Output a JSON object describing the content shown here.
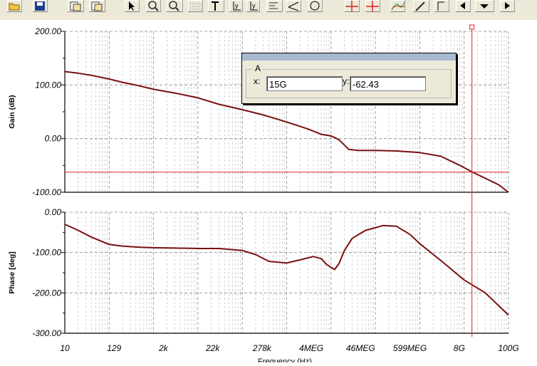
{
  "colors": {
    "trace": "#7a1010",
    "cursor": "#e02020",
    "grid": "#b4b4b4",
    "toolbar_bg": "#ece9d8"
  },
  "toolbar": {
    "icons": [
      "open-folder-icon",
      "save-icon",
      "copy-icon",
      "paste-icon",
      "pointer-icon",
      "zoom-icon",
      "zoom-100-icon",
      "grid-icon",
      "text-tool-icon",
      "axis-y-icon",
      "axis-y2-icon",
      "format-icon",
      "line-tool-icon",
      "circle-tool-icon",
      "cursor-a-icon",
      "cursor-b-icon",
      "curves-icon",
      "pen-icon",
      "marker-icon",
      "scroll-left-icon",
      "dropdown-icon",
      "scroll-right-icon"
    ]
  },
  "cursor_window": {
    "group_label": "A",
    "x_label": "x:",
    "y_label": "y:",
    "x_value": "15G",
    "y_value": "-62.43"
  },
  "chart_data": [
    {
      "type": "line",
      "ylabel": "Gain (dB)",
      "ylim": [
        -100,
        200
      ],
      "yticks": [
        "200.00",
        "100.00",
        "0.00",
        "-100.00"
      ],
      "xscale": "log",
      "xlim": [
        10,
        100000000000
      ],
      "grid": true,
      "x": [
        10,
        20,
        40,
        100,
        200,
        500,
        1000,
        3000,
        10000,
        30000,
        100000,
        300000,
        1000000,
        3000000,
        6000000,
        10000000,
        15000000,
        20000000,
        25000000,
        40000000,
        100000000,
        300000000,
        1000000000,
        3000000000,
        8000000000,
        15000000000,
        30000000000,
        60000000000,
        100000000000
      ],
      "series": [
        {
          "values": [
            125,
            122,
            118,
            111,
            105,
            98,
            92,
            85,
            76,
            64,
            54,
            44,
            31,
            18,
            8,
            5,
            -2,
            -12,
            -20,
            -22,
            -22,
            -23,
            -26,
            -33,
            -50,
            -62,
            -74,
            -86,
            -100
          ]
        }
      ]
    },
    {
      "type": "line",
      "ylabel": "Phase [deg]",
      "ylim": [
        -300,
        0
      ],
      "yticks": [
        "0.00",
        "-100.00",
        "-200.00",
        "-300.00"
      ],
      "xscale": "log",
      "xlim": [
        10,
        100000000000
      ],
      "xticks": [
        "10",
        "129",
        "2k",
        "22k",
        "278k",
        "4MEG",
        "46MEG",
        "599MEG",
        "8G",
        "100G"
      ],
      "xlabel": "Frequency (Hz)",
      "grid": true,
      "x": [
        10,
        20,
        40,
        100,
        200,
        500,
        1000,
        3000,
        10000,
        30000,
        100000,
        200000,
        400000,
        1000000,
        2000000,
        4000000,
        6000000,
        8000000,
        12000000,
        15000000,
        20000000,
        30000000,
        60000000,
        150000000,
        300000000,
        600000000,
        1000000000,
        3000000000,
        10000000000,
        30000000000,
        100000000000
      ],
      "series": [
        {
          "values": [
            -30,
            -45,
            -62,
            -80,
            -84,
            -87,
            -88,
            -89,
            -90,
            -90,
            -95,
            -105,
            -122,
            -126,
            -118,
            -110,
            -115,
            -130,
            -142,
            -128,
            -95,
            -65,
            -45,
            -33,
            -35,
            -55,
            -78,
            -120,
            -168,
            -200,
            -255
          ]
        }
      ],
      "cursor_x": 15000000000
    }
  ]
}
